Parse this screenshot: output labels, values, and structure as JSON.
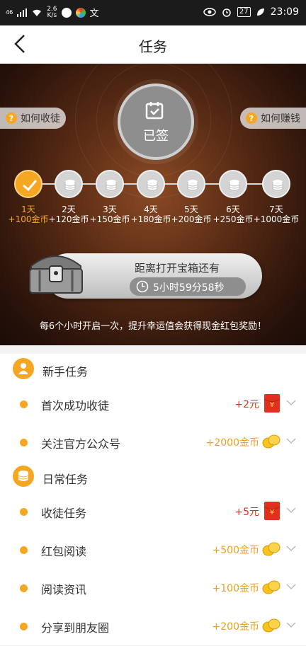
{
  "status_bar": {
    "signal": "46",
    "net_speed_top": "2.6",
    "net_speed_bottom": "K/s",
    "battery": "27",
    "time": "23:09"
  },
  "header": {
    "title": "任务",
    "back_icon": "back-arrow-icon"
  },
  "hero": {
    "signin_label": "已签",
    "left_pill": "如何收徒",
    "right_pill": "如何赚钱",
    "days": [
      {
        "day": "1天",
        "reward": "+100金币",
        "checked": true
      },
      {
        "day": "2天",
        "reward": "+120金币",
        "checked": false
      },
      {
        "day": "3天",
        "reward": "+150金币",
        "checked": false
      },
      {
        "day": "4天",
        "reward": "+180金币",
        "checked": false
      },
      {
        "day": "5天",
        "reward": "+200金币",
        "checked": false
      },
      {
        "day": "6天",
        "reward": "+250金币",
        "checked": false
      },
      {
        "day": "7天",
        "reward": "+1000金币",
        "checked": false
      }
    ],
    "chest_title": "距离打开宝箱还有",
    "chest_timer": "5小时59分58秒",
    "hint": "每6个小时开启一次，提升幸运值会获得现金红包奖励！"
  },
  "sections": [
    {
      "title": "新手任务",
      "icon": "user-icon",
      "tasks": [
        {
          "label": "首次成功收徒",
          "reward": "+2元",
          "reward_type": "cash"
        },
        {
          "label": "关注官方公众号",
          "reward": "+2000金币",
          "reward_type": "coin"
        }
      ]
    },
    {
      "title": "日常任务",
      "icon": "coins-icon",
      "tasks": [
        {
          "label": "收徒任务",
          "reward": "+5元",
          "reward_type": "cash"
        },
        {
          "label": "红包阅读",
          "reward": "+500金币",
          "reward_type": "coin"
        },
        {
          "label": "阅读资讯",
          "reward": "+100金币",
          "reward_type": "coin"
        },
        {
          "label": "分享到朋友圈",
          "reward": "+200金币",
          "reward_type": "coin"
        }
      ]
    }
  ],
  "colors": {
    "accent": "#f5a623",
    "cash_red": "#e2301f",
    "coin_gold": "#e9a21a"
  }
}
